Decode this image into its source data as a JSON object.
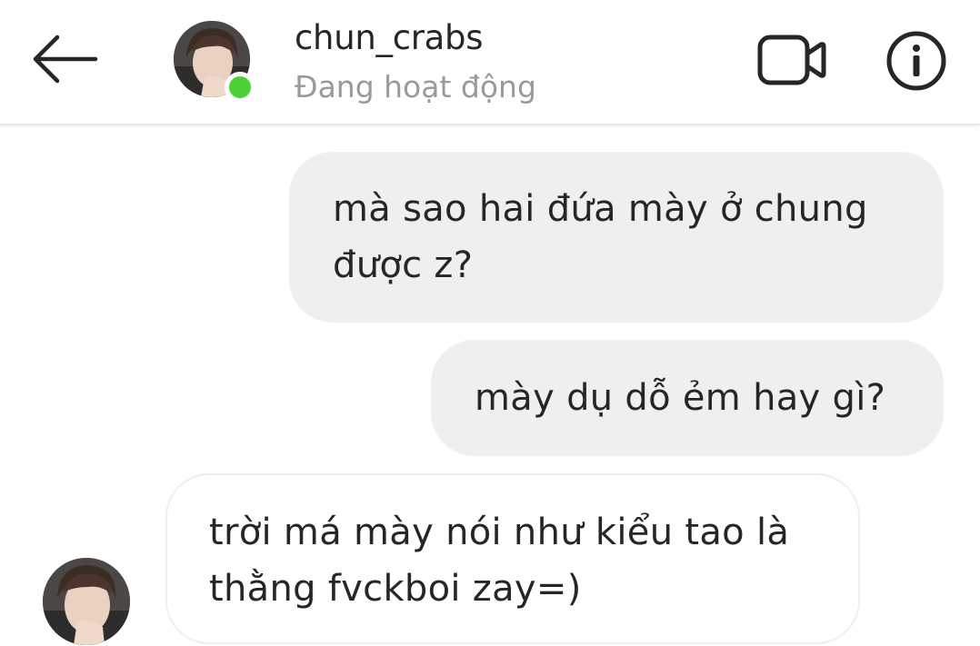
{
  "header": {
    "username": "chun_crabs",
    "status": "Đang hoạt động",
    "online_color": "#4cd137",
    "icons": [
      "back-arrow-icon",
      "video-camera-icon",
      "info-icon"
    ]
  },
  "messages": [
    {
      "sender": "me",
      "text": "mà sao hai đứa mày ở chung\nđược z?"
    },
    {
      "sender": "me",
      "text": "mày dụ dỗ ẻm hay gì?"
    },
    {
      "sender": "chun_crabs",
      "text": "trời má mày nói như kiểu tao là\nthằng fvckboi zay=)"
    }
  ]
}
